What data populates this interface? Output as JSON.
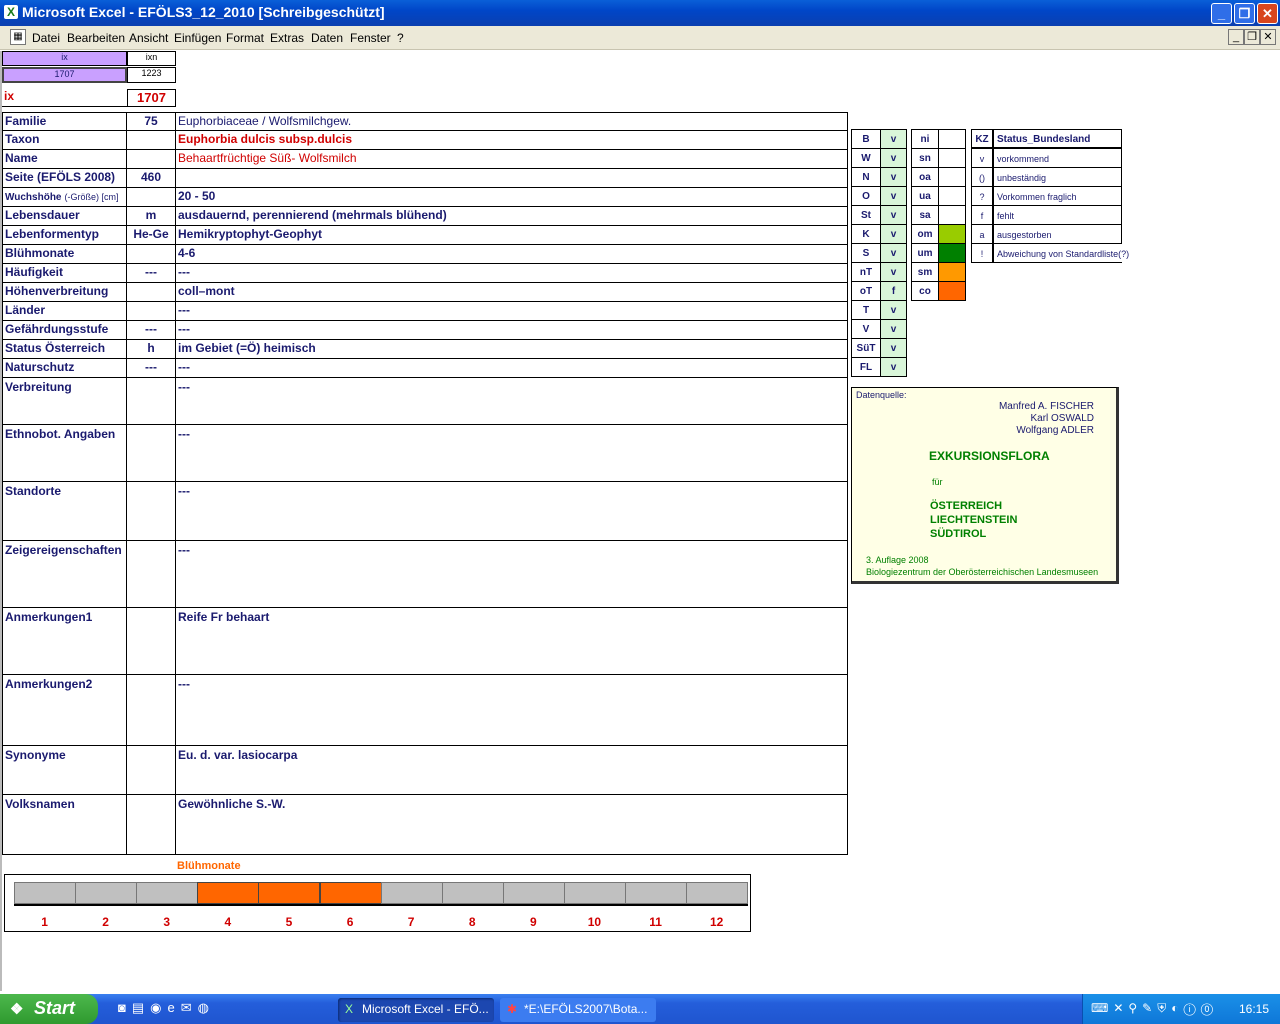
{
  "window": {
    "title": "Microsoft Excel - EFÖLS3_12_2010  [Schreibgeschützt]"
  },
  "menu": {
    "items": [
      "Datei",
      "Bearbeiten",
      "Ansicht",
      "Einfügen",
      "Format",
      "Extras",
      "Daten",
      "Fenster",
      "?"
    ]
  },
  "top_cells": {
    "ix_hdr": "ix",
    "ixn_hdr": "ixn",
    "ix_val": "1707",
    "ixn_val": "1223",
    "ix_label": "ix",
    "ix_big": "1707"
  },
  "rows": [
    {
      "label": "Familie",
      "code": "75",
      "value": "Euphorbiaceae  /  Wolfsmilchgew."
    },
    {
      "label": "Taxon",
      "code": "",
      "value": "Euphorbia dulcis subsp.dulcis"
    },
    {
      "label": "Name",
      "code": "",
      "value": "Behaartfrüchtige Süß- Wolfsmilch"
    },
    {
      "label": "Seite (EFÖLS 2008)",
      "code": "460",
      "value": ""
    },
    {
      "label": "Wuchshöhe",
      "label_sub": "(-Größe) [cm]",
      "code": "",
      "value": " 20 - 50"
    },
    {
      "label": "Lebensdauer",
      "code": "m",
      "value": "ausdauernd, perennierend (mehrmals blühend)"
    },
    {
      "label": "Lebenformentyp",
      "code": "He-Ge",
      "value": "Hemikryptophyt-Geophyt"
    },
    {
      "label": "Blühmonate",
      "code": "",
      "value": " 4-6"
    },
    {
      "label": "Häufigkeit",
      "code": "---",
      "value": " ---"
    },
    {
      "label": "Höhenverbreitung",
      "code": "",
      "value": "coll–mont"
    },
    {
      "label": "Länder",
      "code": "",
      "value": " ---"
    },
    {
      "label": "Gefährdungsstufe",
      "code": "---",
      "value": "   ---"
    },
    {
      "label": "Status Österreich",
      "code": "h",
      "value": "im Gebiet (=Ö) heimisch"
    },
    {
      "label": "Naturschutz",
      "code": "---",
      "value": " ---"
    },
    {
      "label": "Verbreitung",
      "code": "",
      "value": " ---"
    },
    {
      "label": "Ethnobot. Angaben",
      "code": "",
      "value": "---"
    },
    {
      "label": "Standorte",
      "code": "",
      "value": "---"
    },
    {
      "label": "Zeigereigenschaften",
      "code": "",
      "value": "---"
    },
    {
      "label": "Anmerkungen1",
      "code": "",
      "value": "Reife Fr behaart"
    },
    {
      "label": "Anmerkungen2",
      "code": "",
      "value": "---"
    },
    {
      "label": "Synonyme",
      "code": "",
      "value": "Eu. d. var. lasiocarpa"
    },
    {
      "label": "Volksnamen",
      "code": "",
      "value": "Gewöhnliche S.-W."
    }
  ],
  "regions": {
    "codes": [
      "B",
      "W",
      "N",
      "O",
      "St",
      "K",
      "S",
      "nT",
      "oT",
      "T",
      "V",
      "SüT",
      "FL"
    ],
    "vals": [
      "v",
      "v",
      "v",
      "v",
      "v",
      "v",
      "v",
      "v",
      "f",
      "v",
      "v",
      "v",
      "v"
    ]
  },
  "altitude": {
    "codes": [
      "ni",
      "sn",
      "oa",
      "ua",
      "sa",
      "om",
      "um",
      "sm",
      "co"
    ],
    "colors": [
      "#ffffff",
      "#ffffff",
      "#ffffff",
      "#ffffff",
      "#ffffff",
      "#99cc00",
      "#008000",
      "#ff9900",
      "#ff6600"
    ]
  },
  "status_legend": {
    "kz_header": "KZ",
    "header": "Status_Bundesland",
    "rows": [
      {
        "kz": "v",
        "text": "vorkommend"
      },
      {
        "kz": "()",
        "text": "unbeständig"
      },
      {
        "kz": "?",
        "text": "Vorkommen fraglich"
      },
      {
        "kz": "f",
        "text": "fehlt"
      },
      {
        "kz": "a",
        "text": "ausgestorben"
      },
      {
        "kz": "!",
        "text": "Abweichung von Standardliste(?)"
      }
    ]
  },
  "source": {
    "label": "Datenquelle:",
    "authors": [
      "Manfred A. FISCHER",
      "Karl OSWALD",
      "Wolfgang ADLER"
    ],
    "title": "EXKURSIONSFLORA",
    "fuer": "für",
    "countries": [
      "ÖSTERREICH",
      "LIECHTENSTEIN",
      "SÜDTIROL"
    ],
    "edition": "3. Auflage 2008",
    "publisher": "Biologiezentrum der Oberösterreichischen Landesmuseen"
  },
  "bloom": {
    "title": "Blühmonate",
    "months": [
      "1",
      "2",
      "3",
      "4",
      "5",
      "6",
      "7",
      "8",
      "9",
      "10",
      "11",
      "12"
    ],
    "active": [
      false,
      false,
      false,
      true,
      true,
      true,
      false,
      false,
      false,
      false,
      false,
      false
    ],
    "active_color": "#ff6600"
  },
  "taskbar": {
    "start": "Start",
    "tasks": [
      "Microsoft Excel - EFÖ...",
      "*E:\\EFÖLS2007\\Bota..."
    ],
    "clock": "16:15"
  }
}
